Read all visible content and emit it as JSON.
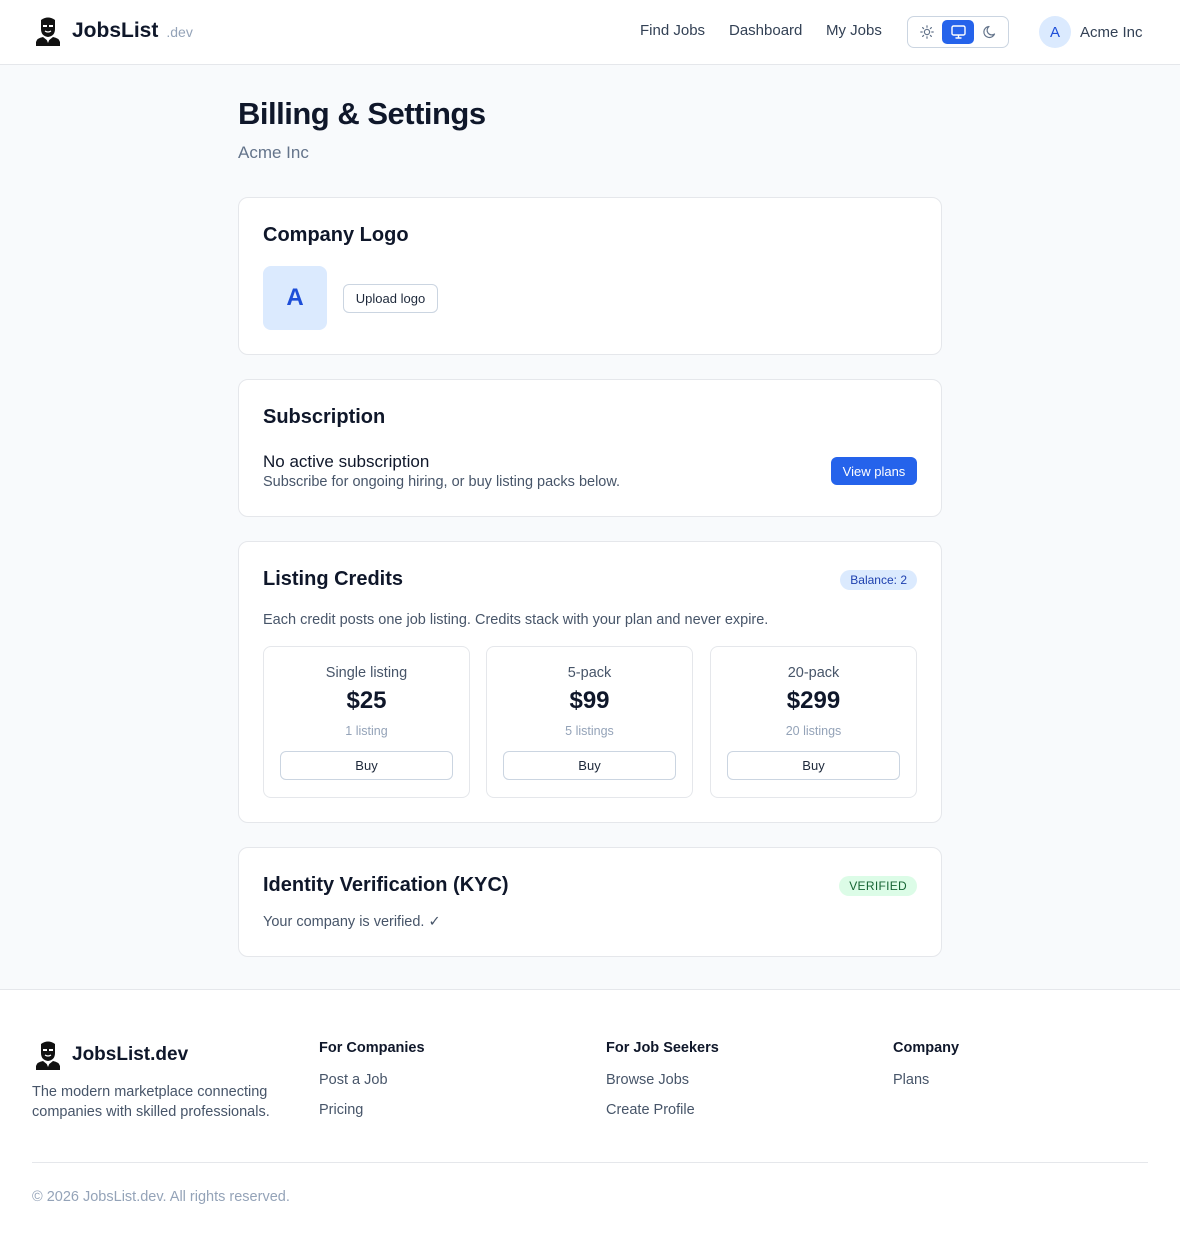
{
  "header": {
    "brand_name": "JobsList",
    "brand_suffix": ".dev",
    "nav": [
      {
        "label": "Find Jobs"
      },
      {
        "label": "Dashboard"
      },
      {
        "label": "My Jobs"
      }
    ],
    "theme_options": [
      "sun-icon",
      "monitor-icon",
      "moon-icon"
    ],
    "theme_selected": "monitor-icon",
    "user_initial": "A",
    "user_name": "Acme Inc"
  },
  "page": {
    "title": "Billing & Settings",
    "subtitle": "Acme Inc"
  },
  "logo_card": {
    "title": "Company Logo",
    "initial": "A",
    "upload_label": "Upload logo"
  },
  "subscription": {
    "title": "Subscription",
    "status": "No active subscription",
    "description": "Subscribe for ongoing hiring, or buy listing packs below.",
    "button_label": "View plans"
  },
  "credits": {
    "title": "Listing Credits",
    "balance_label": "Balance: 2",
    "description": "Each credit posts one job listing. Credits stack with your plan and never expire.",
    "packs": [
      {
        "name": "Single listing",
        "price": "$25",
        "count": "1 listing",
        "button": "Buy"
      },
      {
        "name": "5-pack",
        "price": "$99",
        "count": "5 listings",
        "button": "Buy"
      },
      {
        "name": "20-pack",
        "price": "$299",
        "count": "20 listings",
        "button": "Buy"
      }
    ]
  },
  "kyc": {
    "title": "Identity Verification (KYC)",
    "badge": "VERIFIED",
    "text": "Your company is verified. ✓"
  },
  "footer": {
    "brand_name": "JobsList.dev",
    "tagline": "The modern marketplace connecting companies with skilled professionals.",
    "columns": [
      {
        "title": "For Companies",
        "links": [
          "Post a Job",
          "Pricing"
        ]
      },
      {
        "title": "For Job Seekers",
        "links": [
          "Browse Jobs",
          "Create Profile"
        ]
      },
      {
        "title": "Company",
        "links": [
          "Plans"
        ]
      }
    ],
    "copyright": "© 2026 JobsList.dev. All rights reserved."
  },
  "colors": {
    "primary": "#2563eb",
    "avatar_bg": "#dbeafe",
    "verified_bg": "#dcfce7",
    "verified_text": "#166534"
  }
}
